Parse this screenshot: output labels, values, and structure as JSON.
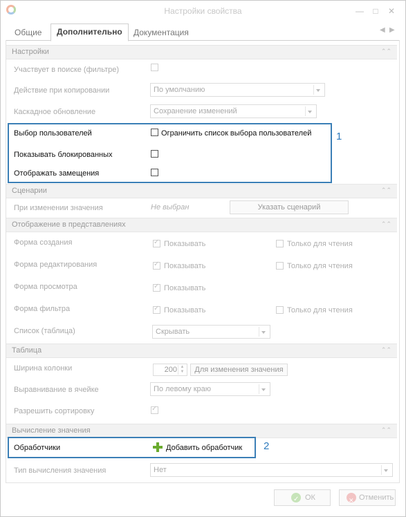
{
  "window": {
    "title": "Настройки свойства"
  },
  "tabs": [
    {
      "label": "Общие"
    },
    {
      "label": "Дополнительно"
    },
    {
      "label": "Документация"
    }
  ],
  "sections": {
    "settings": "Настройки",
    "scenarios": "Сценарии",
    "display": "Отображение в представлениях",
    "table": "Таблица",
    "calc": "Вычисление значения"
  },
  "settings": {
    "search_label": "Участвует в поиске (фильтре)",
    "copy_label": "Действие при копировании",
    "copy_value": "По умолчанию",
    "cascade_label": "Каскадное обновление",
    "cascade_value": "Сохранение изменений",
    "user_select_label": "Выбор пользователей",
    "user_select_check": "Ограничить список выбора пользователей",
    "show_blocked_label": "Показывать блокированных",
    "show_subst_label": "Отображать замещения"
  },
  "scenarios": {
    "on_change_label": "При изменении значения",
    "on_change_value": "Не выбран",
    "specify_button": "Указать сценарий"
  },
  "display": {
    "form_create": "Форма создания",
    "form_edit": "Форма редактирования",
    "form_view": "Форма просмотра",
    "form_filter": "Форма фильтра",
    "list_label": "Список (таблица)",
    "show": "Показывать",
    "readonly": "Только для чтения",
    "list_value": "Скрывать"
  },
  "table": {
    "width_label": "Ширина колонки",
    "width_value": "200",
    "width_button": "Для изменения значения",
    "align_label": "Выравнивание в ячейке",
    "align_value": "По левому краю",
    "sort_label": "Разрешить сортировку"
  },
  "calc": {
    "handlers_label": "Обработчики",
    "add_handler": "Добавить обработчик",
    "type_label": "Тип вычисления значения",
    "type_value": "Нет"
  },
  "annotations": {
    "n1": "1",
    "n2": "2"
  },
  "footer": {
    "ok": "ОК",
    "cancel": "Отменить"
  },
  "colors": {
    "highlight": "#3b7fb6",
    "add_icon": "#6aab2e"
  }
}
